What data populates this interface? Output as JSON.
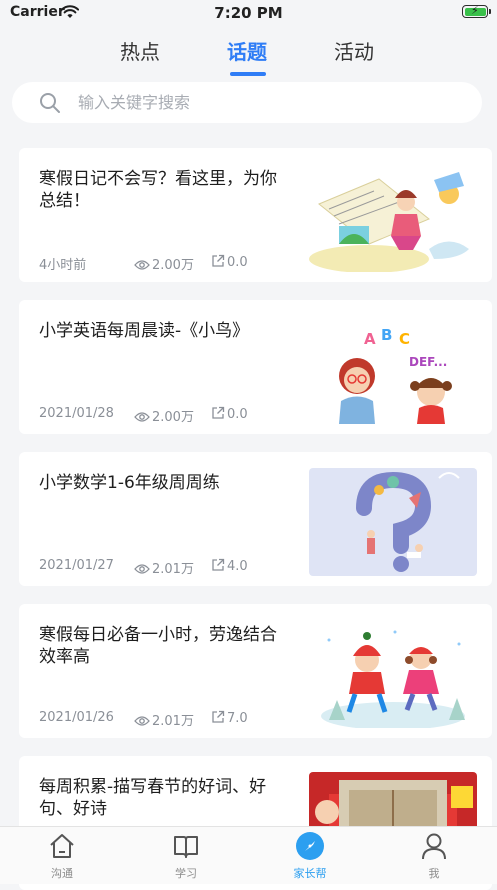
{
  "status_bar": {
    "carrier": "Carrier",
    "time": "7:20 PM"
  },
  "tabs": [
    {
      "label": "热点",
      "active": false
    },
    {
      "label": "话题",
      "active": true
    },
    {
      "label": "活动",
      "active": false
    }
  ],
  "search": {
    "placeholder": "输入关键字搜索",
    "value": ""
  },
  "articles": [
    {
      "title": "寒假日记不会写？看这里，为你总结！",
      "date": "4小时前",
      "views": "2.00万",
      "shares": "0.0",
      "thumb_icon": "diary-illustration"
    },
    {
      "title": "小学英语每周晨读-《小鸟》",
      "date": "2021/01/28",
      "views": "2.00万",
      "shares": "0.0",
      "thumb_icon": "english-teacher-illustration"
    },
    {
      "title": "小学数学1-6年级周周练",
      "date": "2021/01/27",
      "views": "2.01万",
      "shares": "4.0",
      "thumb_icon": "math-question-illustration"
    },
    {
      "title": "寒假每日必备一小时，劳逸结合效率高",
      "date": "2021/01/26",
      "views": "2.01万",
      "shares": "7.0",
      "thumb_icon": "skating-kids-illustration"
    },
    {
      "title": "每周积累-描写春节的好词、好句、好诗",
      "thumb_icon": "spring-festival-illustration"
    }
  ],
  "tabbar": [
    {
      "label": "沟通",
      "icon": "home-icon",
      "active": false
    },
    {
      "label": "学习",
      "icon": "book-icon",
      "active": false
    },
    {
      "label": "家长帮",
      "icon": "compass-icon",
      "active": true
    },
    {
      "label": "我",
      "icon": "user-icon",
      "active": false
    }
  ],
  "colors": {
    "accent": "#2f7df6",
    "tabbar_active": "#2c9ff0",
    "background": "#f4f5f7"
  }
}
